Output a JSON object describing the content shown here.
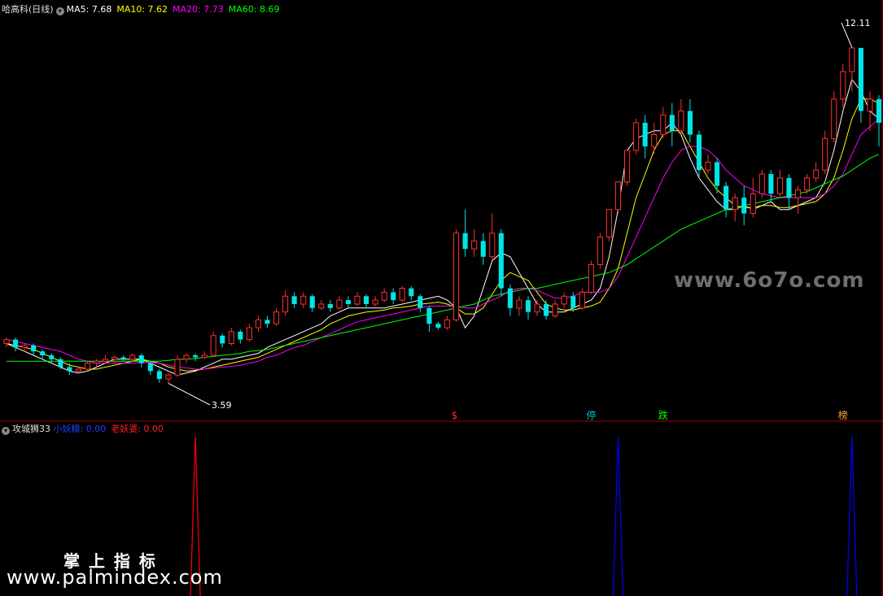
{
  "header": {
    "stock_title": "哈高科(日线)",
    "ma5": {
      "label": "MA5:",
      "value": "7.68",
      "color": "#ffffff"
    },
    "ma10": {
      "label": "MA10:",
      "value": "7.62",
      "color": "#ffff00"
    },
    "ma20": {
      "label": "MA20:",
      "value": "7.73",
      "color": "#ff00ff"
    },
    "ma60": {
      "label": "MA60:",
      "value": "8.69",
      "color": "#00ff00"
    }
  },
  "indicator": {
    "name": "攻城狮33",
    "s1_label": "小妖精:",
    "s1_value": "0.00",
    "s1_color": "#0000ff",
    "s2_label": "老妖婆:",
    "s2_value": "0.00",
    "s2_color": "#ff0000"
  },
  "annotations": {
    "high_label": "12.11",
    "low_label": "3.59",
    "markers": [
      {
        "text": "$",
        "color": "#ff3030"
      },
      {
        "text": "停",
        "color": "#00c0c0"
      },
      {
        "text": "跌",
        "color": "#00ff00"
      },
      {
        "text": "榜",
        "color": "#ffa040"
      }
    ]
  },
  "watermark": {
    "site1": "www.6o7o.com",
    "brand": "掌 上 指 标",
    "site2": "www.palmindex.com"
  },
  "chart_data": [
    {
      "type": "candlestick",
      "title": "哈高科(日线)",
      "ylim": [
        3.0,
        12.8
      ],
      "high": 12.11,
      "low": 3.59,
      "series": [
        {
          "name": "MA5",
          "color": "#ffffff",
          "values": [
            4.6,
            4.5,
            4.4,
            4.3,
            4.2,
            4.1,
            4.0,
            3.9,
            3.85,
            3.9,
            4.0,
            4.1,
            4.2,
            4.2,
            4.2,
            4.2,
            4.1,
            4.0,
            3.9,
            3.8,
            3.85,
            3.9,
            4.0,
            4.1,
            4.2,
            4.2,
            4.25,
            4.3,
            4.35,
            4.5,
            4.6,
            4.7,
            4.8,
            4.9,
            5.0,
            5.1,
            5.3,
            5.4,
            5.5,
            5.5,
            5.5,
            5.5,
            5.5,
            5.55,
            5.6,
            5.65,
            5.7,
            5.75,
            5.8,
            5.7,
            5.5,
            5.0,
            5.3,
            6.0,
            6.7,
            6.9,
            6.8,
            6.4,
            6.0,
            5.6,
            5.4,
            5.4,
            5.4,
            5.5,
            5.6,
            5.7,
            6.0,
            6.8,
            8.0,
            9.5,
            9.8,
            9.9,
            10.0,
            10.0,
            10.2,
            9.9,
            9.3,
            8.8,
            8.5,
            8.2,
            8.0,
            8.0,
            8.1,
            8.0,
            8.1,
            8.2,
            8.0,
            8.0,
            8.1,
            8.2,
            8.3,
            8.7,
            9.5,
            10.5,
            11.3,
            11.0,
            10.5,
            10.3
          ]
        },
        {
          "name": "MA10",
          "color": "#ffff00",
          "values": [
            4.6,
            4.55,
            4.5,
            4.45,
            4.35,
            4.25,
            4.15,
            4.05,
            4.0,
            3.95,
            3.95,
            4.0,
            4.05,
            4.1,
            4.15,
            4.2,
            4.15,
            4.1,
            4.0,
            3.95,
            3.9,
            3.92,
            3.95,
            4.0,
            4.05,
            4.1,
            4.15,
            4.2,
            4.25,
            4.35,
            4.45,
            4.55,
            4.65,
            4.75,
            4.85,
            4.95,
            5.1,
            5.2,
            5.3,
            5.35,
            5.4,
            5.42,
            5.45,
            5.5,
            5.52,
            5.55,
            5.6,
            5.62,
            5.65,
            5.6,
            5.5,
            5.35,
            5.35,
            5.5,
            5.85,
            6.2,
            6.4,
            6.3,
            6.2,
            5.9,
            5.6,
            5.5,
            5.45,
            5.45,
            5.5,
            5.55,
            5.65,
            6.0,
            6.5,
            7.4,
            8.3,
            8.9,
            9.5,
            9.9,
            10.0,
            10.0,
            9.6,
            9.2,
            8.8,
            8.5,
            8.3,
            8.1,
            8.05,
            8.05,
            8.1,
            8.1,
            8.05,
            8.05,
            8.1,
            8.15,
            8.2,
            8.4,
            8.8,
            9.5,
            10.3,
            10.8,
            10.8,
            10.7
          ]
        },
        {
          "name": "MA20",
          "color": "#ff00ff",
          "values": [
            4.7,
            4.65,
            4.6,
            4.55,
            4.5,
            4.45,
            4.4,
            4.3,
            4.2,
            4.15,
            4.1,
            4.1,
            4.1,
            4.1,
            4.1,
            4.12,
            4.12,
            4.1,
            4.05,
            4.0,
            3.98,
            3.95,
            3.95,
            3.98,
            4.0,
            4.02,
            4.05,
            4.1,
            4.15,
            4.25,
            4.3,
            4.4,
            4.5,
            4.55,
            4.65,
            4.75,
            4.85,
            4.95,
            5.05,
            5.15,
            5.2,
            5.25,
            5.3,
            5.35,
            5.4,
            5.45,
            5.5,
            5.55,
            5.55,
            5.55,
            5.55,
            5.5,
            5.5,
            5.6,
            5.7,
            5.8,
            5.95,
            6.0,
            6.0,
            5.95,
            5.85,
            5.75,
            5.75,
            5.8,
            5.9,
            5.9,
            5.9,
            6.0,
            6.3,
            6.8,
            7.3,
            7.8,
            8.3,
            8.8,
            9.2,
            9.5,
            9.6,
            9.6,
            9.5,
            9.3,
            9.0,
            8.8,
            8.6,
            8.5,
            8.4,
            8.35,
            8.3,
            8.3,
            8.3,
            8.3,
            8.3,
            8.4,
            8.6,
            8.9,
            9.4,
            9.9,
            10.1,
            10.3
          ]
        },
        {
          "name": "MA60",
          "color": "#00ff00",
          "values": [
            4.15,
            4.15,
            4.15,
            4.15,
            4.15,
            4.15,
            4.15,
            4.15,
            4.15,
            4.15,
            4.15,
            4.15,
            4.15,
            4.15,
            4.15,
            4.15,
            4.15,
            4.15,
            4.17,
            4.2,
            4.2,
            4.22,
            4.25,
            4.27,
            4.3,
            4.32,
            4.35,
            4.4,
            4.42,
            4.45,
            4.5,
            4.55,
            4.6,
            4.65,
            4.7,
            4.75,
            4.8,
            4.85,
            4.9,
            4.95,
            5.0,
            5.05,
            5.1,
            5.15,
            5.2,
            5.25,
            5.3,
            5.35,
            5.4,
            5.45,
            5.5,
            5.55,
            5.6,
            5.7,
            5.8,
            5.85,
            5.9,
            5.95,
            6.0,
            6.0,
            6.05,
            6.1,
            6.15,
            6.2,
            6.25,
            6.3,
            6.35,
            6.4,
            6.5,
            6.6,
            6.75,
            6.9,
            7.05,
            7.2,
            7.35,
            7.5,
            7.6,
            7.7,
            7.8,
            7.9,
            8.0,
            8.05,
            8.1,
            8.15,
            8.2,
            8.25,
            8.3,
            8.35,
            8.4,
            8.45,
            8.55,
            8.65,
            8.75,
            8.85,
            9.0,
            9.15,
            9.3,
            9.4
          ]
        }
      ],
      "candles": [
        [
          4.6,
          4.7,
          4.5,
          4.75
        ],
        [
          4.7,
          4.5,
          4.4,
          4.75
        ],
        [
          4.5,
          4.55,
          4.4,
          4.6
        ],
        [
          4.55,
          4.4,
          4.3,
          4.6
        ],
        [
          4.4,
          4.3,
          4.2,
          4.45
        ],
        [
          4.3,
          4.2,
          4.1,
          4.35
        ],
        [
          4.2,
          4.0,
          3.95,
          4.25
        ],
        [
          4.0,
          3.9,
          3.8,
          4.1
        ],
        [
          3.9,
          3.95,
          3.85,
          4.0
        ],
        [
          3.95,
          4.1,
          3.9,
          4.15
        ],
        [
          4.1,
          4.15,
          4.0,
          4.2
        ],
        [
          4.15,
          4.2,
          4.1,
          4.3
        ],
        [
          4.2,
          4.25,
          4.1,
          4.3
        ],
        [
          4.25,
          4.2,
          4.15,
          4.3
        ],
        [
          4.2,
          4.3,
          4.15,
          4.35
        ],
        [
          4.3,
          4.1,
          4.0,
          4.35
        ],
        [
          4.1,
          3.9,
          3.8,
          4.15
        ],
        [
          3.9,
          3.7,
          3.6,
          3.95
        ],
        [
          3.7,
          3.8,
          3.59,
          3.85
        ],
        [
          3.8,
          4.2,
          3.75,
          4.3
        ],
        [
          4.2,
          4.3,
          4.1,
          4.35
        ],
        [
          4.3,
          4.25,
          4.15,
          4.35
        ],
        [
          4.25,
          4.3,
          4.2,
          4.4
        ],
        [
          4.3,
          4.8,
          4.25,
          4.9
        ],
        [
          4.8,
          4.6,
          4.5,
          4.85
        ],
        [
          4.6,
          4.9,
          4.55,
          5.0
        ],
        [
          4.9,
          4.7,
          4.6,
          4.95
        ],
        [
          4.7,
          5.0,
          4.65,
          5.1
        ],
        [
          5.0,
          5.2,
          4.9,
          5.3
        ],
        [
          5.2,
          5.1,
          5.0,
          5.3
        ],
        [
          5.1,
          5.4,
          5.05,
          5.5
        ],
        [
          5.4,
          5.8,
          5.3,
          5.95
        ],
        [
          5.8,
          5.6,
          5.5,
          5.9
        ],
        [
          5.6,
          5.8,
          5.5,
          5.9
        ],
        [
          5.8,
          5.5,
          5.4,
          5.85
        ],
        [
          5.5,
          5.6,
          5.45,
          5.7
        ],
        [
          5.6,
          5.5,
          5.4,
          5.7
        ],
        [
          5.5,
          5.7,
          5.45,
          5.8
        ],
        [
          5.7,
          5.6,
          5.5,
          5.8
        ],
        [
          5.6,
          5.8,
          5.55,
          5.9
        ],
        [
          5.8,
          5.6,
          5.5,
          5.85
        ],
        [
          5.6,
          5.7,
          5.55,
          5.8
        ],
        [
          5.7,
          5.9,
          5.65,
          6.0
        ],
        [
          5.9,
          5.7,
          5.6,
          6.0
        ],
        [
          5.7,
          6.0,
          5.65,
          6.05
        ],
        [
          6.0,
          5.8,
          5.7,
          6.05
        ],
        [
          5.8,
          5.5,
          5.4,
          5.85
        ],
        [
          5.5,
          5.1,
          4.9,
          5.55
        ],
        [
          5.1,
          5.0,
          4.95,
          5.15
        ],
        [
          5.0,
          5.2,
          4.95,
          5.3
        ],
        [
          5.2,
          7.4,
          5.15,
          7.5
        ],
        [
          7.4,
          7.0,
          6.8,
          8.0
        ],
        [
          7.0,
          7.2,
          6.8,
          7.5
        ],
        [
          7.2,
          6.8,
          6.6,
          7.4
        ],
        [
          6.8,
          7.4,
          6.7,
          7.9
        ],
        [
          7.4,
          6.0,
          5.8,
          7.5
        ],
        [
          6.0,
          5.5,
          5.3,
          6.1
        ],
        [
          5.5,
          5.7,
          5.3,
          5.8
        ],
        [
          5.7,
          5.4,
          5.2,
          5.8
        ],
        [
          5.4,
          5.6,
          5.3,
          5.7
        ],
        [
          5.6,
          5.3,
          5.2,
          5.7
        ],
        [
          5.3,
          5.6,
          5.25,
          5.7
        ],
        [
          5.6,
          5.8,
          5.5,
          5.9
        ],
        [
          5.8,
          5.5,
          5.4,
          5.9
        ],
        [
          5.5,
          5.9,
          5.45,
          6.0
        ],
        [
          5.9,
          6.6,
          5.85,
          6.7
        ],
        [
          6.6,
          7.3,
          6.5,
          7.4
        ],
        [
          7.3,
          8.0,
          7.2,
          8.0
        ],
        [
          8.0,
          8.7,
          7.9,
          8.7
        ],
        [
          8.7,
          9.5,
          8.6,
          9.5
        ],
        [
          9.5,
          10.2,
          9.4,
          10.3
        ],
        [
          10.2,
          9.6,
          9.3,
          10.4
        ],
        [
          9.6,
          9.9,
          9.4,
          10.2
        ],
        [
          9.9,
          10.4,
          9.8,
          10.6
        ],
        [
          10.4,
          10.0,
          9.6,
          10.7
        ],
        [
          10.0,
          10.5,
          9.9,
          10.8
        ],
        [
          10.5,
          9.9,
          9.7,
          10.8
        ],
        [
          9.9,
          9.0,
          8.8,
          10.0
        ],
        [
          9.0,
          9.2,
          8.9,
          9.4
        ],
        [
          9.2,
          8.6,
          8.4,
          9.3
        ],
        [
          8.6,
          8.0,
          7.8,
          8.7
        ],
        [
          8.0,
          8.3,
          7.7,
          8.4
        ],
        [
          8.3,
          7.9,
          7.6,
          8.6
        ],
        [
          7.9,
          8.4,
          7.8,
          8.8
        ],
        [
          8.4,
          8.9,
          8.3,
          9.0
        ],
        [
          8.9,
          8.4,
          8.2,
          9.0
        ],
        [
          8.4,
          8.8,
          8.3,
          9.0
        ],
        [
          8.8,
          8.3,
          8.0,
          8.9
        ],
        [
          8.3,
          8.5,
          7.9,
          8.6
        ],
        [
          8.5,
          8.8,
          8.4,
          8.9
        ],
        [
          8.8,
          9.0,
          8.7,
          9.2
        ],
        [
          9.0,
          9.8,
          8.9,
          10.0
        ],
        [
          9.8,
          10.8,
          9.7,
          11.0
        ],
        [
          10.8,
          11.5,
          10.6,
          11.7
        ],
        [
          11.5,
          12.1,
          11.0,
          12.11
        ],
        [
          12.1,
          10.5,
          10.2,
          12.1
        ],
        [
          10.5,
          10.8,
          10.0,
          11.0
        ],
        [
          10.8,
          10.2,
          9.6,
          10.9
        ]
      ]
    },
    {
      "type": "line",
      "title": "攻城狮33",
      "ylim": [
        0,
        1
      ],
      "series": [
        {
          "name": "小妖精",
          "color": "#0000ff",
          "peaks": [
            {
              "at": 68,
              "value": 1
            },
            {
              "at": 94,
              "value": 1
            }
          ]
        },
        {
          "name": "老妖婆",
          "color": "#ff0000",
          "peaks": [
            {
              "at": 21,
              "value": 1
            }
          ]
        }
      ]
    }
  ]
}
